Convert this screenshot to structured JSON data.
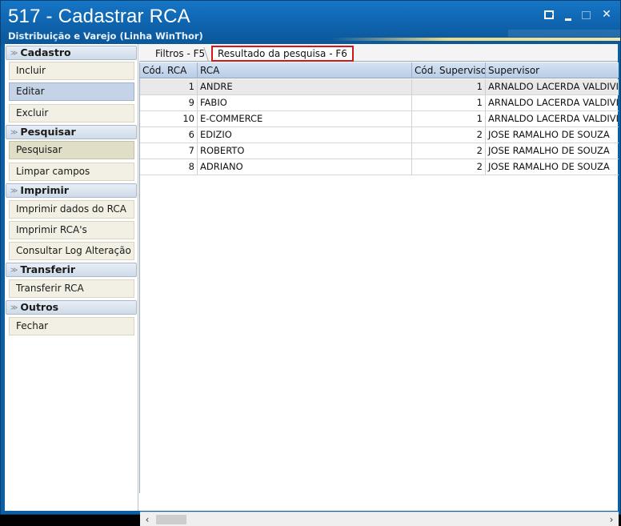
{
  "window": {
    "title": "517 - Cadastrar RCA",
    "subtitle": "Distribuição e Varejo (Linha WinThor)",
    "controls": {
      "restore": "restore-icon",
      "minimize": "minimize-icon",
      "maximize": "maximize-icon",
      "close": "✕"
    }
  },
  "sidebar": {
    "groups": [
      {
        "title": "Cadastro",
        "items": [
          "Incluir",
          "Editar",
          "Excluir"
        ]
      },
      {
        "title": "Pesquisar",
        "items": [
          "Pesquisar",
          "Limpar campos"
        ]
      },
      {
        "title": "Imprimir",
        "items": [
          "Imprimir dados do RCA",
          "Imprimir RCA's",
          "Consultar Log Alteração"
        ]
      },
      {
        "title": "Transferir",
        "items": [
          "Transferir RCA"
        ]
      },
      {
        "title": "Outros",
        "items": [
          "Fechar"
        ]
      }
    ],
    "selected_item": "Editar",
    "pressed_item": "Pesquisar"
  },
  "tabs": {
    "filtros": "Filtros - F5",
    "resultado": "Resultado da pesquisa - F6",
    "active": "resultado"
  },
  "grid": {
    "columns": [
      "Cód. RCA",
      "RCA",
      "Cód. Supervisor",
      "Supervisor"
    ],
    "rows": [
      [
        "1",
        "ANDRE",
        "1",
        "ARNALDO LACERDA VALDIVINO"
      ],
      [
        "9",
        "FABIO",
        "1",
        "ARNALDO LACERDA VALDIVINO"
      ],
      [
        "10",
        "E-COMMERCE",
        "1",
        "ARNALDO LACERDA VALDIVINO"
      ],
      [
        "6",
        "EDIZIO",
        "2",
        "JOSE RAMALHO DE SOUZA"
      ],
      [
        "7",
        "ROBERTO",
        "2",
        "JOSE RAMALHO DE SOUZA"
      ],
      [
        "8",
        "ADRIANO",
        "2",
        "JOSE RAMALHO DE SOUZA"
      ]
    ]
  },
  "scrollbar": {
    "left": "‹",
    "right": "›"
  },
  "colors": {
    "title_bg": "#0f63ad",
    "tab_highlight": "#d01818",
    "selected_item": "#c4d3e6"
  }
}
